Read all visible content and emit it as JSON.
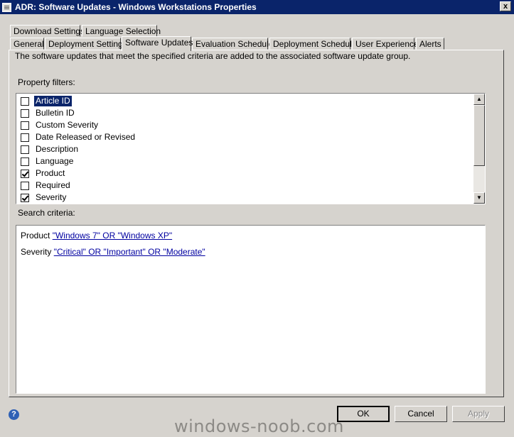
{
  "window": {
    "title": "ADR: Software Updates - Windows Workstations Properties",
    "close_glyph": "x"
  },
  "tabs_row1": [
    {
      "label": "Download Settings"
    },
    {
      "label": "Language Selection"
    }
  ],
  "tabs_row2": [
    {
      "label": "General"
    },
    {
      "label": "Deployment Settings"
    },
    {
      "label": "Software Updates",
      "active": true
    },
    {
      "label": "Evaluation Schedule"
    },
    {
      "label": "Deployment Schedule"
    },
    {
      "label": "User Experience"
    },
    {
      "label": "Alerts"
    }
  ],
  "panel": {
    "description": "The software updates that meet the specified criteria are added to the associated software update group.",
    "property_filters_label": "Property filters:",
    "search_criteria_label": "Search criteria:"
  },
  "property_filters": [
    {
      "label": "Article ID",
      "checked": false,
      "selected": true
    },
    {
      "label": "Bulletin ID",
      "checked": false
    },
    {
      "label": "Custom Severity",
      "checked": false
    },
    {
      "label": "Date Released or Revised",
      "checked": false
    },
    {
      "label": "Description",
      "checked": false
    },
    {
      "label": "Language",
      "checked": false
    },
    {
      "label": "Product",
      "checked": true
    },
    {
      "label": "Required",
      "checked": false
    },
    {
      "label": "Severity",
      "checked": true
    }
  ],
  "search_criteria": [
    {
      "field": "Product",
      "value": "\"Windows 7\" OR \"Windows XP\""
    },
    {
      "field": "Severity",
      "value": "\"Critical\" OR \"Important\" OR \"Moderate\""
    }
  ],
  "buttons": {
    "ok": "OK",
    "cancel": "Cancel",
    "apply": "Apply"
  },
  "help_glyph": "?",
  "watermark": "windows-noob.com"
}
